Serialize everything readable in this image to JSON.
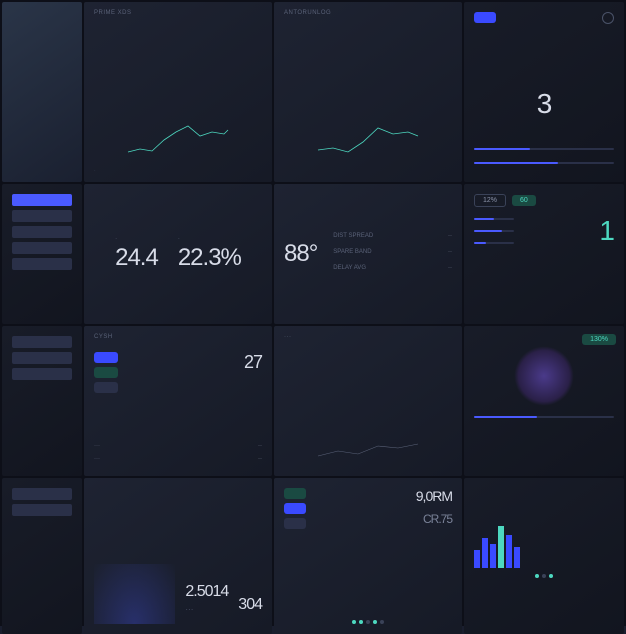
{
  "row1": {
    "sidebar_label": "",
    "panel_a_label": "PRIME XDS",
    "panel_b_label": "ANTORUNLOG",
    "right_a_label": "",
    "right_a_value": "3"
  },
  "chart_data": {
    "type": "line",
    "x": [
      0,
      1,
      2,
      3,
      4,
      5,
      6,
      7,
      8,
      9
    ],
    "values": [
      30,
      35,
      32,
      48,
      60,
      70,
      55,
      62,
      58,
      65
    ],
    "ylim": [
      0,
      100
    ],
    "color": "#4dd8c0"
  },
  "row2": {
    "metric_a": "24.4",
    "metric_a_sub": "",
    "metric_b": "22.3%",
    "metric_c": "88°",
    "list_labels": [
      "DIST SPREAD",
      "SPARE BAND",
      "DELAY AVG"
    ],
    "right_badge_a": "12%",
    "right_badge_b": "60",
    "right_value": "1",
    "right_list": [
      "",
      "",
      ""
    ]
  },
  "row3": {
    "sidebar_items": [
      "",
      "",
      "",
      ""
    ],
    "left_label": "CYSH",
    "left_value": "27",
    "btn_a": "",
    "btn_b": "",
    "center_label": "",
    "right_badge": "130%",
    "right_value": ""
  },
  "row4": {
    "left_value": "2.5014",
    "center_value": "304",
    "right_a": "9,0RM",
    "right_b": "CR.75",
    "buttons": [
      "",
      "",
      ""
    ]
  }
}
